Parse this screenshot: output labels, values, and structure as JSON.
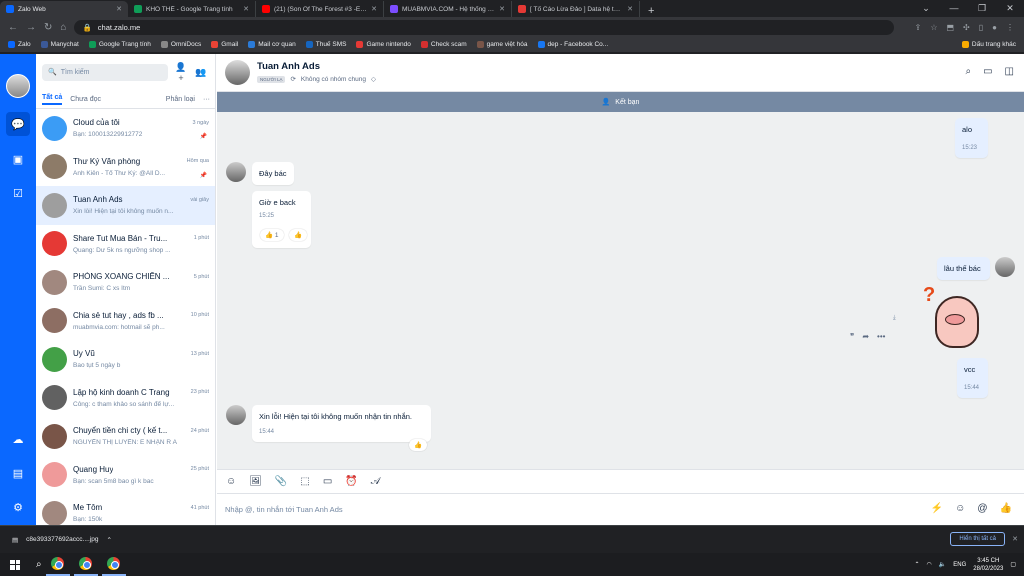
{
  "browser": {
    "tabs": [
      {
        "title": "Zalo Web",
        "color": "#0a68ff",
        "active": true
      },
      {
        "title": "KHO THẺ - Google Trang tính",
        "color": "#0f9d58"
      },
      {
        "title": "(21) (Son Of The Forest #3 -End) H...",
        "color": "#ff0000"
      },
      {
        "title": "MUABMVIA.COM - Hệ thống Mua B...",
        "color": "#7c4dff"
      },
      {
        "title": "[ Tố Cáo Lừa Đảo ] Data hệ thống ...",
        "color": "#e53935"
      }
    ],
    "new_tab": "+",
    "url": "chat.zalo.me",
    "bookmarks": [
      "Zalo",
      "Manychat",
      "Google Trang tính",
      "OmniDocs",
      "Gmail",
      "Mail cơ quan",
      "Thuế SMS",
      "Game nintendo",
      "Check scam",
      "game việt hóa",
      "dep - Facebook Co..."
    ],
    "bookmark_colors": [
      "#0a68ff",
      "#3b5998",
      "#0f9d58",
      "#888888",
      "#ea4335",
      "#2b7bd8",
      "#1565c0",
      "#e53935",
      "#d32f2f",
      "#795548",
      "#1877f2"
    ],
    "bookmarks_right": "Dấu trang khác"
  },
  "sidebar": {
    "search_placeholder": "Tìm kiếm",
    "filters": {
      "all": "Tất cả",
      "unread": "Chưa đọc",
      "sort": "Phân loại",
      "more": "···"
    },
    "conversations": [
      {
        "name": "Cloud của tôi",
        "time": "3 ngày",
        "preview": "Bạn: 100013229912772",
        "pin": "📌",
        "color": "#3b9cf5"
      },
      {
        "name": "Thư Ký Văn phòng",
        "time": "Hôm qua",
        "preview": "Anh Kiên - Tổ Thư Ký: @All D...",
        "pin": "📌",
        "color": "#8d7b68"
      },
      {
        "name": "Tuan Anh Ads",
        "time": "vài giây",
        "preview": "Xin lỗi! Hiện tại tôi không muốn n...",
        "color": "#9e9e9e",
        "selected": true
      },
      {
        "name": "Share Tut Mua Bán - Tru...",
        "time": "1 phút",
        "preview": "Quang: Dư 5k ns ngưỡng shop ...",
        "color": "#e53935"
      },
      {
        "name": "PHÒNG XOANG CHIẾN ...",
        "time": "5 phút",
        "preview": "Trần Sumi: C xs Itm",
        "color": "#a1887f"
      },
      {
        "name": "Chia sẻ tut hay , ads fb ...",
        "time": "10 phút",
        "preview": "muabmvia.com: hotmail sẽ ph...",
        "color": "#8d6e63"
      },
      {
        "name": "Uy Vũ",
        "time": "13 phút",
        "preview": "Bao tụt 5 ngày b",
        "color": "#43a047"
      },
      {
        "name": "Lập hộ kinh doanh C Trang",
        "time": "23 phút",
        "preview": "Công: c tham khảo so sánh để lự...",
        "color": "#616161"
      },
      {
        "name": "Chuyển tiền chi cty ( kế t...",
        "time": "24 phút",
        "preview": "NGUYỄN THỊ LUYẾN: E NHẬN R A",
        "color": "#795548"
      },
      {
        "name": "Quang Huy",
        "time": "25 phút",
        "preview": "Bạn: scan 5m8 bao gì k bac",
        "color": "#ef9a9a"
      },
      {
        "name": "Me Tôm",
        "time": "41 phút",
        "preview": "Bạn: 150k",
        "color": "#a1887f"
      }
    ]
  },
  "chat": {
    "name": "Tuan Anh Ads",
    "tag": "NGƯỜI LẠ",
    "common_groups": "Không có nhóm chung",
    "add_friend": "Kết bạn",
    "messages": [
      {
        "text": "alo",
        "time": "15:23"
      },
      {
        "text": "Đây bác"
      },
      {
        "text": "Giờ e back",
        "time": "15:25",
        "reaction": "👍 1"
      },
      {
        "text": "lâu thế bác"
      },
      {
        "text": "vcc",
        "time": "15:44"
      },
      {
        "text": "Xin lỗi! Hiện tại tôi không muốn nhận tin nhắn.",
        "time": "15:44"
      }
    ],
    "composer_placeholder": "Nhập @, tin nhắn tới Tuan Anh Ads"
  },
  "download": {
    "file": "c8e393377692accc....jpg",
    "show_all": "Hiển thị tất cả"
  },
  "taskbar": {
    "lang": "ENG",
    "time": "3:45 CH",
    "date": "28/02/2023"
  }
}
